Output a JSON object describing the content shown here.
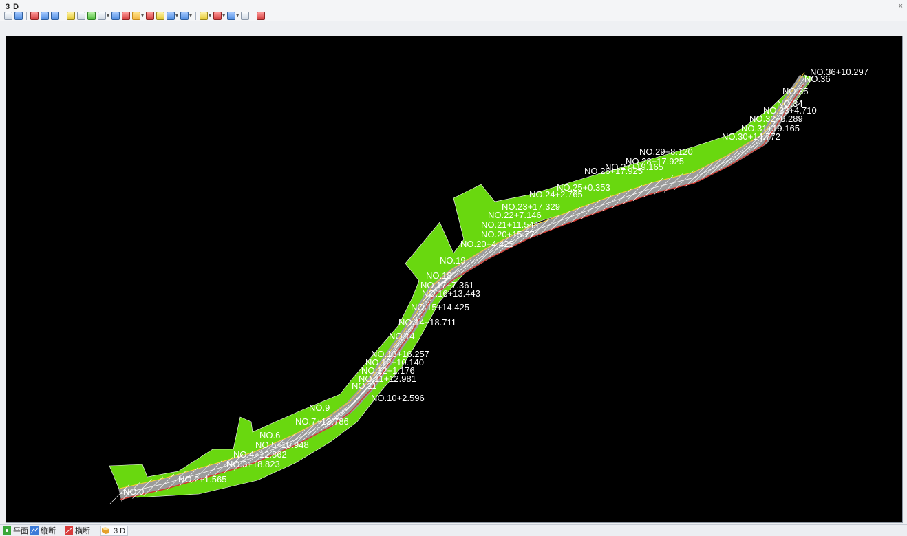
{
  "window": {
    "title": "3 D",
    "close_glyph": "×"
  },
  "toolbar": {
    "items": [
      "save-icon",
      "search-icon",
      "separator",
      "layers-icon",
      "grid-icon",
      "view-icon",
      "separator",
      "light-icon",
      "tool-icon",
      "line-style-icon",
      "line-width-icon",
      "box-icon",
      "frame-icon",
      "highlight-icon",
      "caret",
      "terrain-icon",
      "surface-icon",
      "cube-icon",
      "caret",
      "rotate-icon",
      "caret",
      "separator",
      "measure-icon",
      "caret",
      "color-icon",
      "caret",
      "clip-icon",
      "caret",
      "link-icon",
      "separator",
      "export-icon"
    ]
  },
  "tabs": {
    "items": [
      {
        "label": "平面",
        "icon": "plan-icon",
        "active": false
      },
      {
        "label": "縦断",
        "icon": "profile-icon",
        "active": false
      },
      {
        "label": "横断",
        "icon": "section-icon",
        "active": false
      },
      {
        "label": "3 D",
        "icon": "3d-icon",
        "active": true
      }
    ]
  },
  "viewport": {
    "background": "#000000",
    "colors": {
      "terrain": "#69d80f",
      "road": "#9b9b9b",
      "grid": "#ffffff",
      "edge": "#d23a32"
    },
    "labels": [
      {
        "text": "NO.36+10.297"
      },
      {
        "text": "NO.36"
      },
      {
        "text": "NO.35"
      },
      {
        "text": "NO.34"
      },
      {
        "text": "NO.33+4.710"
      },
      {
        "text": "NO.32+6.289"
      },
      {
        "text": "NO.31+19.165"
      },
      {
        "text": "NO.30+14.772"
      },
      {
        "text": "NO.29+8.120"
      },
      {
        "text": "NO.28+17.925"
      },
      {
        "text": "NO.27+19.165"
      },
      {
        "text": "NO.26+17.925"
      },
      {
        "text": "NO.25+0.353"
      },
      {
        "text": "NO.24+2.765"
      },
      {
        "text": "NO.23+17.329"
      },
      {
        "text": "NO.22+7.146"
      },
      {
        "text": "NO.21+11.544"
      },
      {
        "text": "NO.20+15.771"
      },
      {
        "text": "NO.20+4.425"
      },
      {
        "text": "NO.19"
      },
      {
        "text": "NO.18"
      },
      {
        "text": "NO.17+7.361"
      },
      {
        "text": "NO.16+13.443"
      },
      {
        "text": "NO.15+14.425"
      },
      {
        "text": "NO.14+18.711"
      },
      {
        "text": "NO.14"
      },
      {
        "text": "NO.13+16.257"
      },
      {
        "text": "NO.12+10.140"
      },
      {
        "text": "NO.12+1.176"
      },
      {
        "text": "NO.11+12.981"
      },
      {
        "text": "NO.11"
      },
      {
        "text": "NO.10+2.596"
      },
      {
        "text": "NO.9"
      },
      {
        "text": "NO.7+13.786"
      },
      {
        "text": "NO.6"
      },
      {
        "text": "NO.5+10.948"
      },
      {
        "text": "NO.4+12.862"
      },
      {
        "text": "NO.3+18.823"
      },
      {
        "text": "NO.2+1.565"
      },
      {
        "text": "NO.0"
      }
    ]
  }
}
